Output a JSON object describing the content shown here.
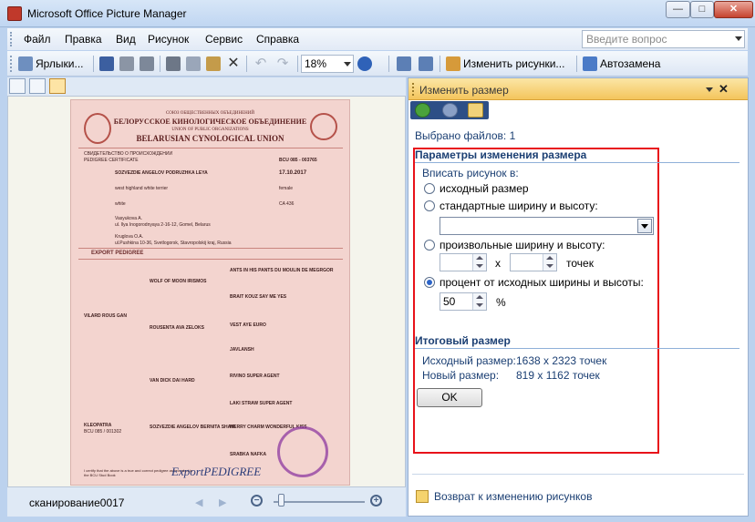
{
  "window": {
    "title": "Microsoft Office Picture Manager",
    "minimize": "—",
    "maximize": "□",
    "close": "✕"
  },
  "menu": [
    "Файл",
    "Правка",
    "Вид",
    "Рисунок",
    "Сервис",
    "Справка"
  ],
  "ask_placeholder": "Введите вопрос",
  "toolbar": {
    "shortcuts_label": "Ярлыки...",
    "zoom": "18%",
    "edit_pictures_label": "Изменить рисунки...",
    "autocorrect_label": "Автозамена"
  },
  "document": {
    "header_ru_small": "СОЮЗ ОБЩЕСТВЕННЫХ ОБЪЕДИНЕНИЙ",
    "header_ru": "БЕЛОРУССКОЕ КИНОЛОГИЧЕСКОЕ ОБЪЕДИНЕНИЕ",
    "header_en_small": "UNION OF PUBLIC ORGANIZATIONS",
    "header_en": "BELARUSIAN CYNOLOGICAL UNION",
    "certificate_ru": "СВИДЕТЕЛЬСТВО О ПРОИСХОЖДЕНИИ",
    "certificate_en": "PEDIGREE CERTIFICATE",
    "reg_no": "BCU 085 - 003765",
    "dog_name": "SOZVEZDIE ANGELOV PODRUZHKA LEYA",
    "birth_date": "17.10.2017",
    "breed": "west highland white terrier",
    "sex": "female",
    "color": "white",
    "tattoo": "CA 436",
    "breeder": "Vasyukova A.",
    "breeder_address": "ul. Ilya Inogorodnyaya 2-16-12, Gomel, Belarus",
    "owner": "Kruglova O.A.",
    "owner_address": "ul.Pushkina 10-36, Svetlogorsk, Stavropolskij kraj, Russia",
    "export_label": "EXPORT PEDIGREE",
    "sire": "WOLF OF MOON IRISMOS",
    "sire_sire": "VILARD ROUS GAN",
    "sire_dam": "ROUSENTA AVA ZELOKS",
    "dam": "VAN DICK DAI HARD",
    "dam_dam": "KLEOPATRA",
    "dam_dam_reg": "BCU 085 / 001302",
    "dam_line": "SOZVEZDIE ANGELOV BERNITA SHAIR",
    "gg1": "ANTS IN HIS PANTS DU MOULIN DE MEGRGOR",
    "gg2": "BRAIT KOUZ SAY ME YES",
    "gg3": "VEST AYE EURO",
    "gg4": "JAVLANSH",
    "gg5": "RIVINO SUPER AGENT",
    "gg6": "LAKI STRAW SUPER AGENT",
    "gg7": "MERRY CHARM WONDERFUL KISS",
    "gg8": "SRABKA NAFKA",
    "footer_note": "I certify that the above is a true and correct pedigree as recorded in the BCU Stud Book",
    "signature": "ExportPEDIGREE"
  },
  "status": {
    "filename": "сканирование0017",
    "zoom_out": "−",
    "zoom_in": "+",
    "prev": "◀",
    "next": "▶",
    "zoom_level_percent": 18
  },
  "pane": {
    "title": "Изменить размер",
    "selected_files": "Выбрано файлов: 1",
    "params_header": "Параметры изменения размера",
    "fit_label": "Вписать рисунок в:",
    "opt_original": "исходный размер",
    "opt_standard": "стандартные ширину и высоту:",
    "opt_custom": "произвольные ширину и высоту:",
    "x_label": "x",
    "points_label": "точек",
    "opt_percent": "процент от исходных ширины и высоты:",
    "percent_value": "50",
    "percent_sign": "%",
    "result_header": "Итоговый размер",
    "original_size_label": "Исходный размер:",
    "original_size_value": "1638 x 2323 точек",
    "new_size_label": "Новый размер:",
    "new_size_value": "819 x 1162 точек",
    "ok": "OK",
    "back_link": "Возврат к изменению рисунков"
  },
  "colors": {
    "highlight_box": "#e8121a",
    "pane_header": "#f4c55c",
    "link_text": "#1b3f73"
  }
}
